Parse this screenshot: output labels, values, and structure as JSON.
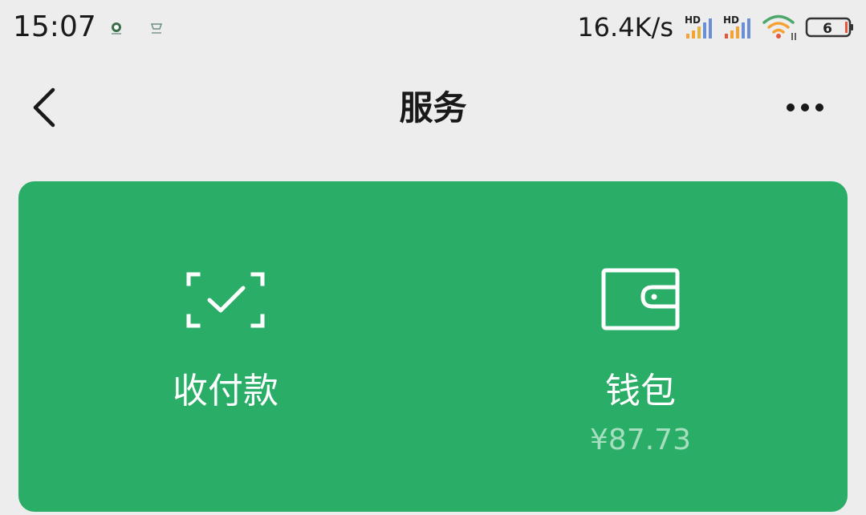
{
  "status_bar": {
    "time": "15:07",
    "net_speed": "16.4K/s",
    "battery": "6",
    "signal_badge": "HD"
  },
  "nav": {
    "title": "服务"
  },
  "card": {
    "background_color": "#2aae67",
    "items": [
      {
        "label": "收付款",
        "icon": "scan-check-icon"
      },
      {
        "label": "钱包",
        "icon": "wallet-icon",
        "balance": "¥87.73"
      }
    ]
  }
}
